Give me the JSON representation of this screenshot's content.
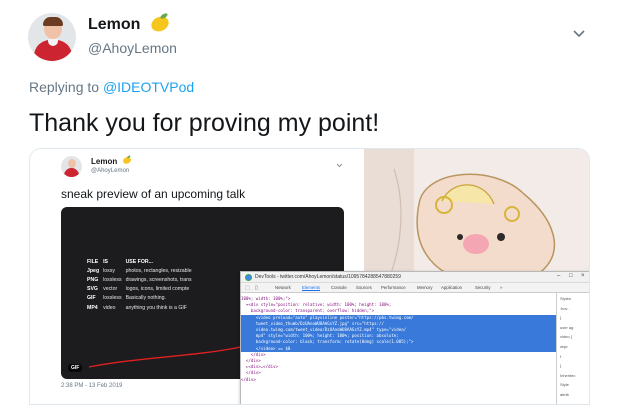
{
  "author": {
    "name": "Lemon",
    "handle": "@AhoyLemon"
  },
  "reply": {
    "prefix": "Replying to ",
    "to": "@IDEOTVPod"
  },
  "text": "Thank you for proving my point!",
  "embedded_tweet": {
    "name": "Lemon",
    "handle": "@AhoyLemon",
    "text": "sneak preview of an upcoming talk",
    "table": {
      "headers": [
        "FILE",
        "IS",
        "USE FOR..."
      ],
      "rows": [
        [
          "Jpeg",
          "lossy",
          "photos, rectangles, resizable"
        ],
        [
          "PNG",
          "lossless",
          "drawings, screenshots, trans"
        ],
        [
          "SVG",
          "vector",
          "logos, icons, limited compte"
        ],
        [
          "GIF",
          "lossless",
          "Basically nothing."
        ],
        [
          "MP4",
          "video",
          "anything you think is a GIF"
        ]
      ]
    },
    "gif_badge": "GIF",
    "timestamp": "2:38 PM - 13 Feb 2019"
  },
  "devtools": {
    "title": "DevTools - twitter.com/AhoyLemon/status/1095784288547880259",
    "tabs": [
      "Network",
      "Elements",
      "Console",
      "Sources",
      "Performance",
      "Memory",
      "Application",
      "Security",
      "»"
    ],
    "active_tab": "Elements",
    "error_count": "2",
    "code_lines": [
      "100%; width: 100%;\">",
      "  ▾<div style=\"position: relative; width: 100%; height: 100%;",
      "    background-color: transparent; overflow: hidden;\">",
      "      <video preload=\"auto\" playsinline poster=\"https://pbs.twimg.com/",
      "      tweet_video_thumb/DzUAnoWU8AAGsYZ.jpg\" src=\"https://",
      "      video.twimg.com/tweet_video/DzUAnoWU8AAGsYZ.mp4\" type=\"video/",
      "      mp4\" style=\"width: 100%; height: 100%; position: absolute;",
      "      background-color: black; transform: rotate(0deg) scale(1.005);\">",
      "      </video> == $0",
      "    </div>",
      "  </div>",
      "  ▸<div>…</div>",
      "  </div>",
      "</div>"
    ],
    "selected_lines_first": 3,
    "selected_lines_count": 6,
    "sidebar": [
      "Styles",
      ":hov .",
      "}",
      "user ag",
      "video {",
      "obje",
      "f",
      "}",
      "Inheritec",
      "Style",
      "attrib"
    ]
  },
  "colors": {
    "link": "#1da1f2",
    "muted": "#657786",
    "text": "#14171a",
    "devtools_selection": "#3879d9"
  }
}
